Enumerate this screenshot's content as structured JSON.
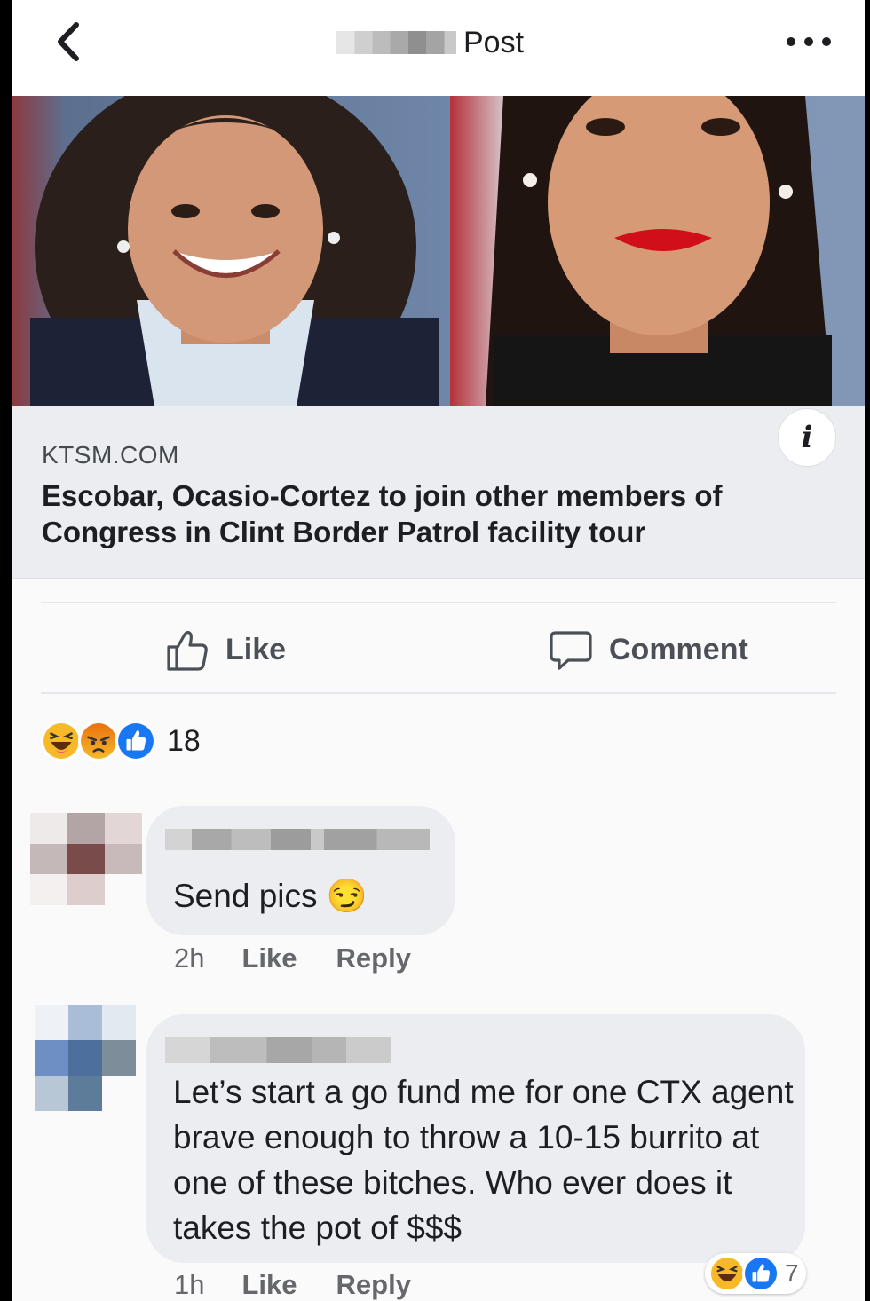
{
  "header": {
    "title": "Post"
  },
  "link": {
    "domain": "KTSM.COM",
    "headline": "Escobar, Ocasio-Cortez to join other members of Congress in Clint Border Patrol facility tour"
  },
  "actions": {
    "like_label": "Like",
    "comment_label": "Comment"
  },
  "reactions": {
    "icons": [
      "haha-reaction-icon",
      "angry-reaction-icon",
      "like-reaction-icon"
    ],
    "count": "18"
  },
  "comments": [
    {
      "text": "Send pics 😏",
      "time": "2h",
      "like_label": "Like",
      "reply_label": "Reply"
    },
    {
      "text": "Let’s start a go fund me for one CTX agent brave enough to throw a 10-15 burrito at one of these bitches. Who ever does it takes the pot of $$$",
      "time": "1h",
      "like_label": "Like",
      "reply_label": "Reply",
      "reactions": {
        "icons": [
          "haha-reaction-icon",
          "like-reaction-icon"
        ],
        "count": "7"
      }
    }
  ],
  "colors": {
    "text_primary": "#1c1e21",
    "text_secondary": "#65676b",
    "like_blue": "#1877f2",
    "card_gray": "#ebedf0"
  }
}
